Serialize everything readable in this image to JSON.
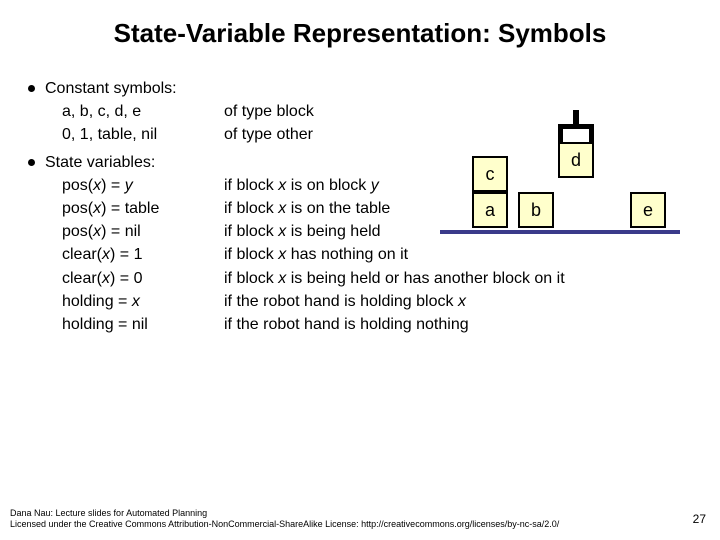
{
  "title": "State-Variable Representation: Symbols",
  "bullets": {
    "b1": "Constant symbols:",
    "b2": "State variables:"
  },
  "const": {
    "l1": "a, b, c, d, e",
    "r1": "of type block",
    "l2": "0, 1, table, nil",
    "r2": "of type other"
  },
  "sv": {
    "l1a": "pos(",
    "l1x": "x",
    "l1b": ") = ",
    "l1y": "y",
    "r1a": "if block ",
    "r1x": "x",
    "r1b": " is on block ",
    "r1y": "y",
    "l2a": "pos(",
    "l2x": "x",
    "l2b": ") = table",
    "r2a": "if block ",
    "r2x": "x",
    "r2b": " is on the table",
    "l3a": "pos(",
    "l3x": "x",
    "l3b": ") = nil",
    "r3a": "if block ",
    "r3x": "x",
    "r3b": " is being held",
    "l4a": "clear(",
    "l4x": "x",
    "l4b": ") = 1",
    "r4a": "if block ",
    "r4x": "x",
    "r4b": " has nothing on it",
    "l5a": "clear(",
    "l5x": "x",
    "l5b": ") = 0",
    "r5a": "if block ",
    "r5x": "x",
    "r5b": " is being held or has another block on it",
    "l6": "holding = ",
    "l6x": "x",
    "r6a": "if the robot hand is holding block ",
    "r6x": "x",
    "l7": "holding = nil",
    "r7": "if the robot hand is holding nothing"
  },
  "blocks": {
    "a": "a",
    "b": "b",
    "c": "c",
    "d": "d",
    "e": "e"
  },
  "footer": {
    "line1": "Dana Nau: Lecture slides for Automated Planning",
    "line2": "Licensed under the Creative Commons Attribution-NonCommercial-ShareAlike License: http://creativecommons.org/licenses/by-nc-sa/2.0/"
  },
  "page": "27"
}
